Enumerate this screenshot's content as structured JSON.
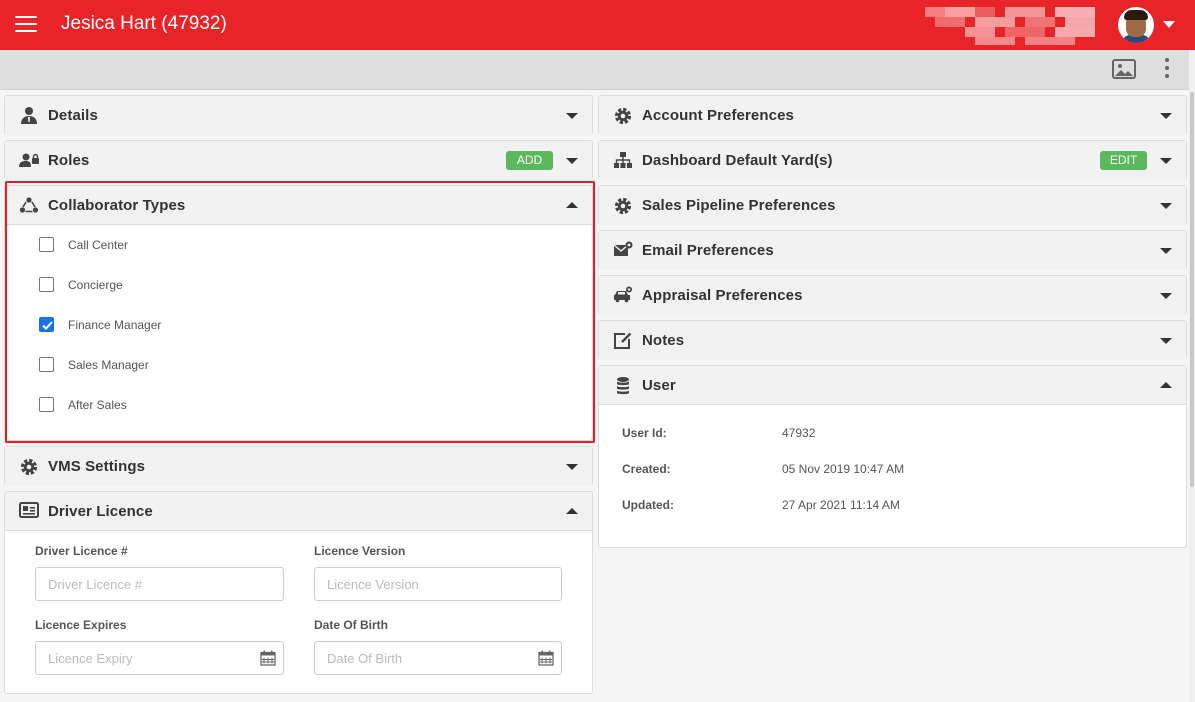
{
  "header": {
    "title": "Jesica Hart (47932)",
    "menu_icon": "hamburger-menu-icon",
    "user_avatar": "user-avatar",
    "colors": {
      "brand": "#e92428",
      "accent_badge": "#5cb85c",
      "highlight": "#e41e26",
      "checkbox": "#1a73e8"
    }
  },
  "toolbar": {
    "image_icon": "image-icon",
    "more_icon": "more-vertical-icon"
  },
  "left_panels": {
    "details": {
      "title": "Details",
      "icon": "user-tie-icon"
    },
    "roles": {
      "title": "Roles",
      "icon": "user-lock-icon",
      "badge": "ADD"
    },
    "collaborator_types": {
      "title": "Collaborator Types",
      "icon": "collaborator-icon",
      "options": [
        {
          "label": "Call Center",
          "checked": false
        },
        {
          "label": "Concierge",
          "checked": false
        },
        {
          "label": "Finance Manager",
          "checked": true
        },
        {
          "label": "Sales Manager",
          "checked": false
        },
        {
          "label": "After Sales",
          "checked": false
        }
      ]
    },
    "vms_settings": {
      "title": "VMS Settings",
      "icon": "gear-icon"
    },
    "driver_licence": {
      "title": "Driver Licence",
      "icon": "id-card-icon",
      "fields": {
        "licence_number": {
          "label": "Driver Licence #",
          "placeholder": "Driver Licence #"
        },
        "licence_version": {
          "label": "Licence Version",
          "placeholder": "Licence Version"
        },
        "licence_expires": {
          "label": "Licence Expires",
          "placeholder": "Licence Expiry"
        },
        "date_of_birth": {
          "label": "Date Of Birth",
          "placeholder": "Date Of Birth"
        }
      }
    }
  },
  "right_panels": {
    "account_preferences": {
      "title": "Account Preferences",
      "icon": "gear-icon"
    },
    "dashboard_yards": {
      "title": "Dashboard Default Yard(s)",
      "icon": "sitemap-icon",
      "badge": "EDIT"
    },
    "sales_pipeline": {
      "title": "Sales Pipeline Preferences",
      "icon": "gear-icon"
    },
    "email_preferences": {
      "title": "Email Preferences",
      "icon": "envelope-gear-icon"
    },
    "appraisal_preferences": {
      "title": "Appraisal Preferences",
      "icon": "car-gear-icon"
    },
    "notes": {
      "title": "Notes",
      "icon": "edit-note-icon"
    },
    "user": {
      "title": "User",
      "icon": "database-icon",
      "rows": {
        "user_id": {
          "label": "User Id:",
          "value": "47932"
        },
        "created": {
          "label": "Created:",
          "value": "05 Nov 2019 10:47 AM"
        },
        "updated": {
          "label": "Updated:",
          "value": "27 Apr 2021 11:14 AM"
        }
      }
    }
  }
}
